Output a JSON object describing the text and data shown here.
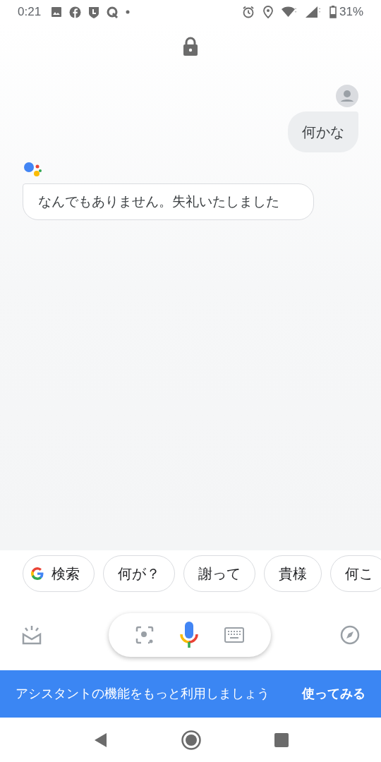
{
  "status_bar": {
    "time": "0:21",
    "battery": "31%"
  },
  "conversation": [
    {
      "kind": "user",
      "text": "何かな"
    },
    {
      "kind": "assistant",
      "text": "なんでもありません。失礼いたしました"
    }
  ],
  "suggestions": [
    {
      "kind": "search",
      "label": "検索"
    },
    {
      "kind": "plain",
      "label": "何が？"
    },
    {
      "kind": "plain",
      "label": "謝って"
    },
    {
      "kind": "plain",
      "label": "貴様"
    },
    {
      "kind": "plain",
      "label": "何こ"
    }
  ],
  "banner": {
    "text": "アシスタントの機能をもっと利用しましょう",
    "action": "使ってみる"
  }
}
